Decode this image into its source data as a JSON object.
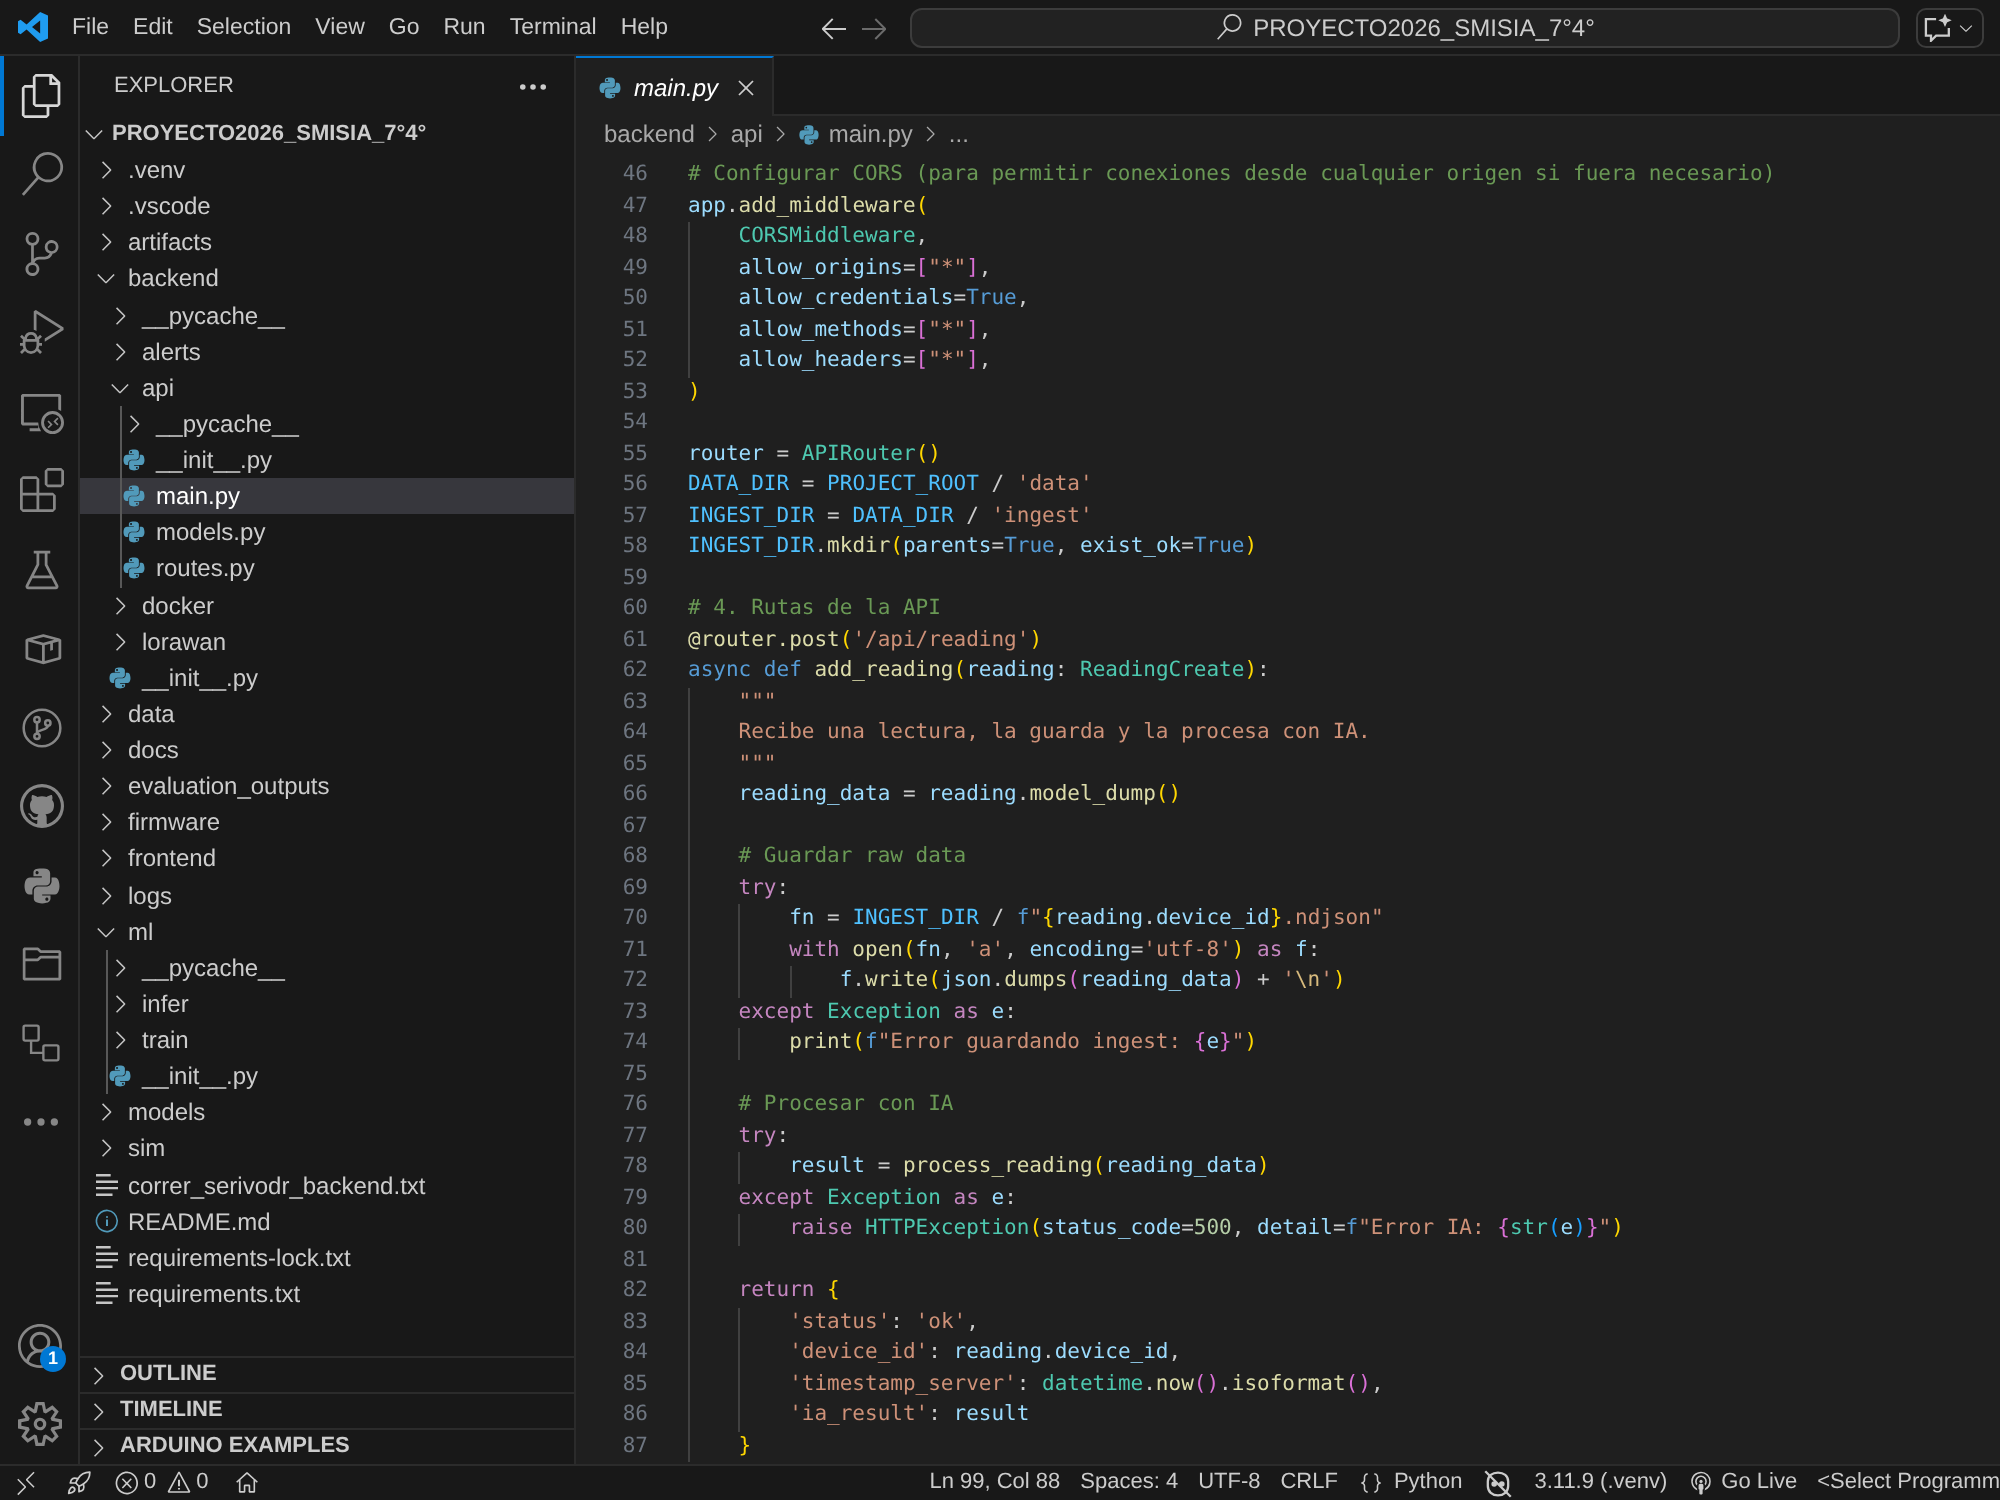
{
  "title_bar": {
    "menu": [
      "File",
      "Edit",
      "Selection",
      "View",
      "Go",
      "Run",
      "Terminal",
      "Help"
    ],
    "command_center": {
      "label": "PROYECTO2026_SMISIA_7°4°"
    }
  },
  "activity_bar": {
    "items": [
      {
        "kind": "explorer",
        "selected": true
      },
      {
        "kind": "search",
        "selected": false
      },
      {
        "kind": "source_control",
        "selected": false
      },
      {
        "kind": "run_debug",
        "selected": false
      },
      {
        "kind": "remote_explorer",
        "selected": false
      },
      {
        "kind": "extensions",
        "selected": false
      },
      {
        "kind": "testing",
        "selected": false
      },
      {
        "kind": "containers",
        "selected": false
      },
      {
        "kind": "git_graph",
        "selected": false
      },
      {
        "kind": "github",
        "selected": false
      },
      {
        "kind": "python",
        "selected": false
      },
      {
        "kind": "folders",
        "selected": false
      },
      {
        "kind": "project_manager",
        "selected": false
      },
      {
        "kind": "more",
        "selected": false
      }
    ],
    "account_badge": "1"
  },
  "explorer": {
    "title": "EXPLORER",
    "root": {
      "label": "PROYECTO2026_SMISIA_7°4°",
      "expanded": true
    },
    "tree": [
      {
        "label": ".venv",
        "kind": "folder",
        "expanded": false,
        "selected": false
      },
      {
        "label": ".vscode",
        "kind": "folder",
        "expanded": false,
        "selected": false
      },
      {
        "label": "artifacts",
        "kind": "folder",
        "expanded": false,
        "selected": false
      },
      {
        "label": "backend",
        "kind": "folder",
        "expanded": true,
        "indent_guide": false,
        "selected": false,
        "children": [
          {
            "label": "__pycache__",
            "kind": "folder",
            "expanded": false,
            "selected": false
          },
          {
            "label": "alerts",
            "kind": "folder",
            "expanded": false,
            "selected": false
          },
          {
            "label": "api",
            "kind": "folder",
            "expanded": true,
            "indent_guide": true,
            "selected": false,
            "children": [
              {
                "label": "__pycache__",
                "kind": "folder",
                "expanded": false,
                "selected": false
              },
              {
                "label": "__init__.py",
                "kind": "python",
                "selected": false
              },
              {
                "label": "main.py",
                "kind": "python",
                "selected": true
              },
              {
                "label": "models.py",
                "kind": "python",
                "selected": false
              },
              {
                "label": "routes.py",
                "kind": "python",
                "selected": false
              }
            ]
          },
          {
            "label": "docker",
            "kind": "folder",
            "expanded": false,
            "selected": false
          },
          {
            "label": "lorawan",
            "kind": "folder",
            "expanded": false,
            "selected": false
          },
          {
            "label": "__init__.py",
            "kind": "python",
            "selected": false
          }
        ]
      },
      {
        "label": "data",
        "kind": "folder",
        "expanded": false,
        "selected": false
      },
      {
        "label": "docs",
        "kind": "folder",
        "expanded": false,
        "selected": false
      },
      {
        "label": "evaluation_outputs",
        "kind": "folder",
        "expanded": false,
        "selected": false
      },
      {
        "label": "firmware",
        "kind": "folder",
        "expanded": false,
        "selected": false
      },
      {
        "label": "frontend",
        "kind": "folder",
        "expanded": false,
        "selected": false
      },
      {
        "label": "logs",
        "kind": "folder",
        "expanded": false,
        "selected": false
      },
      {
        "label": "ml",
        "kind": "folder",
        "expanded": true,
        "indent_guide": true,
        "selected": false,
        "children": [
          {
            "label": "__pycache__",
            "kind": "folder",
            "expanded": false,
            "selected": false
          },
          {
            "label": "infer",
            "kind": "folder",
            "expanded": false,
            "selected": false
          },
          {
            "label": "train",
            "kind": "folder",
            "expanded": false,
            "selected": false
          },
          {
            "label": "__init__.py",
            "kind": "python",
            "selected": false
          }
        ]
      },
      {
        "label": "models",
        "kind": "folder",
        "expanded": false,
        "selected": false
      },
      {
        "label": "sim",
        "kind": "folder",
        "expanded": false,
        "selected": false
      },
      {
        "label": "correr_serivodr_backend.txt",
        "kind": "text",
        "selected": false
      },
      {
        "label": "README.md",
        "kind": "info",
        "selected": false
      },
      {
        "label": "requirements-lock.txt",
        "kind": "text",
        "selected": false
      },
      {
        "label": "requirements.txt",
        "kind": "text",
        "selected": false
      }
    ],
    "sections": [
      {
        "label": "OUTLINE",
        "expanded": false
      },
      {
        "label": "TIMELINE",
        "expanded": false
      },
      {
        "label": "ARDUINO EXAMPLES",
        "expanded": false
      }
    ]
  },
  "editor": {
    "tabs": [
      {
        "label": "main.py",
        "kind": "python",
        "selected": true,
        "preview": true
      }
    ],
    "breadcrumbs": [
      {
        "label": "backend",
        "kind": "folder"
      },
      {
        "label": "api",
        "kind": "folder"
      },
      {
        "label": "main.py",
        "kind": "python"
      },
      {
        "label": "...",
        "kind": "symbol"
      }
    ],
    "lines": [
      {
        "number": "46",
        "tokens": [
          {
            "kind": "comment",
            "text": "# Configurar CORS (para permitir conexiones desde cualquier origen si fuera necesario)"
          }
        ]
      },
      {
        "number": "47",
        "tokens": [
          {
            "kind": "variable",
            "text": "app"
          },
          {
            "kind": "punctuation",
            "text": "."
          },
          {
            "kind": "function",
            "text": "add_middleware"
          },
          {
            "kind": "bracket1",
            "text": "("
          }
        ]
      },
      {
        "number": "48",
        "tokens": [
          {
            "kind": "class",
            "text": "    CORSMiddleware"
          },
          {
            "kind": "punctuation",
            "text": ","
          }
        ]
      },
      {
        "number": "49",
        "tokens": [
          {
            "kind": "variable",
            "text": "    allow_origins"
          },
          {
            "kind": "punctuation",
            "text": "="
          },
          {
            "kind": "bracket2",
            "text": "["
          },
          {
            "kind": "string",
            "text": "\"*\""
          },
          {
            "kind": "bracket2",
            "text": "]"
          },
          {
            "kind": "punctuation",
            "text": ","
          }
        ]
      },
      {
        "number": "50",
        "tokens": [
          {
            "kind": "variable",
            "text": "    allow_credentials"
          },
          {
            "kind": "punctuation",
            "text": "="
          },
          {
            "kind": "storage",
            "text": "True"
          },
          {
            "kind": "punctuation",
            "text": ","
          }
        ]
      },
      {
        "number": "51",
        "tokens": [
          {
            "kind": "variable",
            "text": "    allow_methods"
          },
          {
            "kind": "punctuation",
            "text": "="
          },
          {
            "kind": "bracket2",
            "text": "["
          },
          {
            "kind": "string",
            "text": "\"*\""
          },
          {
            "kind": "bracket2",
            "text": "]"
          },
          {
            "kind": "punctuation",
            "text": ","
          }
        ]
      },
      {
        "number": "52",
        "tokens": [
          {
            "kind": "variable",
            "text": "    allow_headers"
          },
          {
            "kind": "punctuation",
            "text": "="
          },
          {
            "kind": "bracket2",
            "text": "["
          },
          {
            "kind": "string",
            "text": "\"*\""
          },
          {
            "kind": "bracket2",
            "text": "]"
          },
          {
            "kind": "punctuation",
            "text": ","
          }
        ]
      },
      {
        "number": "53",
        "tokens": [
          {
            "kind": "bracket1",
            "text": ")"
          }
        ]
      },
      {
        "number": "54"
      },
      {
        "number": "55",
        "tokens": [
          {
            "kind": "variable",
            "text": "router"
          },
          {
            "kind": "punctuation",
            "text": " = "
          },
          {
            "kind": "class",
            "text": "APIRouter"
          },
          {
            "kind": "bracket1",
            "text": "()"
          }
        ]
      },
      {
        "number": "56",
        "tokens": [
          {
            "kind": "constant",
            "text": "DATA_DIR"
          },
          {
            "kind": "punctuation",
            "text": " = "
          },
          {
            "kind": "constant",
            "text": "PROJECT_ROOT"
          },
          {
            "kind": "punctuation",
            "text": " / "
          },
          {
            "kind": "string",
            "text": "'data'"
          }
        ]
      },
      {
        "number": "57",
        "tokens": [
          {
            "kind": "constant",
            "text": "INGEST_DIR"
          },
          {
            "kind": "punctuation",
            "text": " = "
          },
          {
            "kind": "constant",
            "text": "DATA_DIR"
          },
          {
            "kind": "punctuation",
            "text": " / "
          },
          {
            "kind": "string",
            "text": "'ingest'"
          }
        ]
      },
      {
        "number": "58",
        "tokens": [
          {
            "kind": "constant",
            "text": "INGEST_DIR"
          },
          {
            "kind": "punctuation",
            "text": "."
          },
          {
            "kind": "function",
            "text": "mkdir"
          },
          {
            "kind": "bracket1",
            "text": "("
          },
          {
            "kind": "variable",
            "text": "parents"
          },
          {
            "kind": "punctuation",
            "text": "="
          },
          {
            "kind": "storage",
            "text": "True"
          },
          {
            "kind": "punctuation",
            "text": ", "
          },
          {
            "kind": "variable",
            "text": "exist_ok"
          },
          {
            "kind": "punctuation",
            "text": "="
          },
          {
            "kind": "storage",
            "text": "True"
          },
          {
            "kind": "bracket1",
            "text": ")"
          }
        ]
      },
      {
        "number": "59"
      },
      {
        "number": "60",
        "tokens": [
          {
            "kind": "comment",
            "text": "# 4. Rutas de la API"
          }
        ]
      },
      {
        "number": "61",
        "tokens": [
          {
            "kind": "function",
            "text": "@router.post"
          },
          {
            "kind": "bracket1",
            "text": "("
          },
          {
            "kind": "string",
            "text": "'/api/reading'"
          },
          {
            "kind": "bracket1",
            "text": ")"
          }
        ]
      },
      {
        "number": "62",
        "tokens": [
          {
            "kind": "storage",
            "text": "async def "
          },
          {
            "kind": "function",
            "text": "add_reading"
          },
          {
            "kind": "bracket1",
            "text": "("
          },
          {
            "kind": "variable",
            "text": "reading"
          },
          {
            "kind": "punctuation",
            "text": ": "
          },
          {
            "kind": "class",
            "text": "ReadingCreate"
          },
          {
            "kind": "bracket1",
            "text": ")"
          },
          {
            "kind": "punctuation",
            "text": ":"
          }
        ]
      },
      {
        "number": "63",
        "tokens": [
          {
            "kind": "string",
            "text": "    \"\"\""
          }
        ]
      },
      {
        "number": "64",
        "tokens": [
          {
            "kind": "string",
            "text": "    Recibe una lectura, la guarda y la procesa con IA."
          }
        ]
      },
      {
        "number": "65",
        "tokens": [
          {
            "kind": "string",
            "text": "    \"\"\""
          }
        ]
      },
      {
        "number": "66",
        "tokens": [
          {
            "kind": "variable",
            "text": "    reading_data"
          },
          {
            "kind": "punctuation",
            "text": " = "
          },
          {
            "kind": "variable",
            "text": "reading"
          },
          {
            "kind": "punctuation",
            "text": "."
          },
          {
            "kind": "function",
            "text": "model_dump"
          },
          {
            "kind": "bracket1",
            "text": "()"
          }
        ]
      },
      {
        "number": "67"
      },
      {
        "number": "68",
        "tokens": [
          {
            "kind": "comment",
            "text": "    # Guardar raw data"
          }
        ]
      },
      {
        "number": "69",
        "tokens": [
          {
            "kind": "keyword",
            "text": "    try"
          },
          {
            "kind": "punctuation",
            "text": ":"
          }
        ]
      },
      {
        "number": "70",
        "tokens": [
          {
            "kind": "variable",
            "text": "        fn"
          },
          {
            "kind": "punctuation",
            "text": " = "
          },
          {
            "kind": "constant",
            "text": "INGEST_DIR"
          },
          {
            "kind": "punctuation",
            "text": " / "
          },
          {
            "kind": "storage",
            "text": "f"
          },
          {
            "kind": "string",
            "text": "\""
          },
          {
            "kind": "bracket1",
            "text": "{"
          },
          {
            "kind": "variable",
            "text": "reading"
          },
          {
            "kind": "punctuation",
            "text": "."
          },
          {
            "kind": "variable",
            "text": "device_id"
          },
          {
            "kind": "bracket1",
            "text": "}"
          },
          {
            "kind": "string",
            "text": ".ndjson\""
          }
        ]
      },
      {
        "number": "71",
        "tokens": [
          {
            "kind": "keyword",
            "text": "        with "
          },
          {
            "kind": "function",
            "text": "open"
          },
          {
            "kind": "bracket1",
            "text": "("
          },
          {
            "kind": "variable",
            "text": "fn"
          },
          {
            "kind": "punctuation",
            "text": ", "
          },
          {
            "kind": "string",
            "text": "'a'"
          },
          {
            "kind": "punctuation",
            "text": ", "
          },
          {
            "kind": "variable",
            "text": "encoding"
          },
          {
            "kind": "punctuation",
            "text": "="
          },
          {
            "kind": "string",
            "text": "'utf-8'"
          },
          {
            "kind": "bracket1",
            "text": ")"
          },
          {
            "kind": "keyword",
            "text": " as "
          },
          {
            "kind": "variable",
            "text": "f"
          },
          {
            "kind": "punctuation",
            "text": ":"
          }
        ]
      },
      {
        "number": "72",
        "tokens": [
          {
            "kind": "variable",
            "text": "            f"
          },
          {
            "kind": "punctuation",
            "text": "."
          },
          {
            "kind": "function",
            "text": "write"
          },
          {
            "kind": "bracket1",
            "text": "("
          },
          {
            "kind": "variable",
            "text": "json"
          },
          {
            "kind": "punctuation",
            "text": "."
          },
          {
            "kind": "function",
            "text": "dumps"
          },
          {
            "kind": "bracket2",
            "text": "("
          },
          {
            "kind": "variable",
            "text": "reading_data"
          },
          {
            "kind": "bracket2",
            "text": ")"
          },
          {
            "kind": "punctuation",
            "text": " + "
          },
          {
            "kind": "string",
            "text": "'"
          },
          {
            "kind": "escape",
            "text": "\\n"
          },
          {
            "kind": "string",
            "text": "'"
          },
          {
            "kind": "bracket1",
            "text": ")"
          }
        ]
      },
      {
        "number": "73",
        "tokens": [
          {
            "kind": "keyword",
            "text": "    except "
          },
          {
            "kind": "class",
            "text": "Exception"
          },
          {
            "kind": "keyword",
            "text": " as "
          },
          {
            "kind": "variable",
            "text": "e"
          },
          {
            "kind": "punctuation",
            "text": ":"
          }
        ]
      },
      {
        "number": "74",
        "tokens": [
          {
            "kind": "function",
            "text": "        print"
          },
          {
            "kind": "bracket1",
            "text": "("
          },
          {
            "kind": "storage",
            "text": "f"
          },
          {
            "kind": "string",
            "text": "\"Error guardando ingest: "
          },
          {
            "kind": "bracket2",
            "text": "{"
          },
          {
            "kind": "variable",
            "text": "e"
          },
          {
            "kind": "bracket2",
            "text": "}"
          },
          {
            "kind": "string",
            "text": "\""
          },
          {
            "kind": "bracket1",
            "text": ")"
          }
        ]
      },
      {
        "number": "75"
      },
      {
        "number": "76",
        "tokens": [
          {
            "kind": "comment",
            "text": "    # Procesar con IA"
          }
        ]
      },
      {
        "number": "77",
        "tokens": [
          {
            "kind": "keyword",
            "text": "    try"
          },
          {
            "kind": "punctuation",
            "text": ":"
          }
        ]
      },
      {
        "number": "78",
        "tokens": [
          {
            "kind": "variable",
            "text": "        result"
          },
          {
            "kind": "punctuation",
            "text": " = "
          },
          {
            "kind": "function",
            "text": "process_reading"
          },
          {
            "kind": "bracket1",
            "text": "("
          },
          {
            "kind": "variable",
            "text": "reading_data"
          },
          {
            "kind": "bracket1",
            "text": ")"
          }
        ]
      },
      {
        "number": "79",
        "tokens": [
          {
            "kind": "keyword",
            "text": "    except "
          },
          {
            "kind": "class",
            "text": "Exception"
          },
          {
            "kind": "keyword",
            "text": " as "
          },
          {
            "kind": "variable",
            "text": "e"
          },
          {
            "kind": "punctuation",
            "text": ":"
          }
        ]
      },
      {
        "number": "80",
        "tokens": [
          {
            "kind": "keyword",
            "text": "        raise "
          },
          {
            "kind": "class",
            "text": "HTTPException"
          },
          {
            "kind": "bracket1",
            "text": "("
          },
          {
            "kind": "variable",
            "text": "status_code"
          },
          {
            "kind": "punctuation",
            "text": "="
          },
          {
            "kind": "number",
            "text": "500"
          },
          {
            "kind": "punctuation",
            "text": ", "
          },
          {
            "kind": "variable",
            "text": "detail"
          },
          {
            "kind": "punctuation",
            "text": "="
          },
          {
            "kind": "storage",
            "text": "f"
          },
          {
            "kind": "string",
            "text": "\"Error IA: "
          },
          {
            "kind": "bracket2",
            "text": "{"
          },
          {
            "kind": "class",
            "text": "str"
          },
          {
            "kind": "bracket3",
            "text": "("
          },
          {
            "kind": "variable",
            "text": "e"
          },
          {
            "kind": "bracket3",
            "text": ")"
          },
          {
            "kind": "bracket2",
            "text": "}"
          },
          {
            "kind": "string",
            "text": "\""
          },
          {
            "kind": "bracket1",
            "text": ")"
          }
        ]
      },
      {
        "number": "81"
      },
      {
        "number": "82",
        "tokens": [
          {
            "kind": "keyword",
            "text": "    return "
          },
          {
            "kind": "bracket1",
            "text": "{"
          }
        ]
      },
      {
        "number": "83",
        "tokens": [
          {
            "kind": "string",
            "text": "        'status'"
          },
          {
            "kind": "punctuation",
            "text": ": "
          },
          {
            "kind": "string",
            "text": "'ok'"
          },
          {
            "kind": "punctuation",
            "text": ","
          }
        ]
      },
      {
        "number": "84",
        "tokens": [
          {
            "kind": "string",
            "text": "        'device_id'"
          },
          {
            "kind": "punctuation",
            "text": ": "
          },
          {
            "kind": "variable",
            "text": "reading"
          },
          {
            "kind": "punctuation",
            "text": "."
          },
          {
            "kind": "variable",
            "text": "device_id"
          },
          {
            "kind": "punctuation",
            "text": ","
          }
        ]
      },
      {
        "number": "85",
        "tokens": [
          {
            "kind": "string",
            "text": "        'timestamp_server'"
          },
          {
            "kind": "punctuation",
            "text": ": "
          },
          {
            "kind": "class",
            "text": "datetime"
          },
          {
            "kind": "punctuation",
            "text": "."
          },
          {
            "kind": "function",
            "text": "now"
          },
          {
            "kind": "bracket2",
            "text": "()"
          },
          {
            "kind": "punctuation",
            "text": "."
          },
          {
            "kind": "function",
            "text": "isoformat"
          },
          {
            "kind": "bracket2",
            "text": "()"
          },
          {
            "kind": "punctuation",
            "text": ","
          }
        ]
      },
      {
        "number": "86",
        "tokens": [
          {
            "kind": "string",
            "text": "        'ia_result'"
          },
          {
            "kind": "punctuation",
            "text": ": "
          },
          {
            "kind": "variable",
            "text": "result"
          }
        ]
      },
      {
        "number": "87",
        "tokens": [
          {
            "kind": "bracket1",
            "text": "    }"
          }
        ]
      }
    ]
  },
  "status_bar": {
    "problems": {
      "errors": "0",
      "warnings": "0"
    },
    "items": [
      {
        "kind": "position",
        "text": "Ln 99, Col 88"
      },
      {
        "kind": "indentation",
        "text": "Spaces: 4"
      },
      {
        "kind": "encoding",
        "text": "UTF-8"
      },
      {
        "kind": "eol",
        "text": "CRLF"
      },
      {
        "kind": "language",
        "text": "Python"
      },
      {
        "kind": "copilot"
      },
      {
        "kind": "interpreter",
        "text": "3.11.9 (.venv)"
      },
      {
        "kind": "live_server",
        "text": "Go Live"
      },
      {
        "kind": "target",
        "text": "<Select Programm"
      }
    ]
  }
}
